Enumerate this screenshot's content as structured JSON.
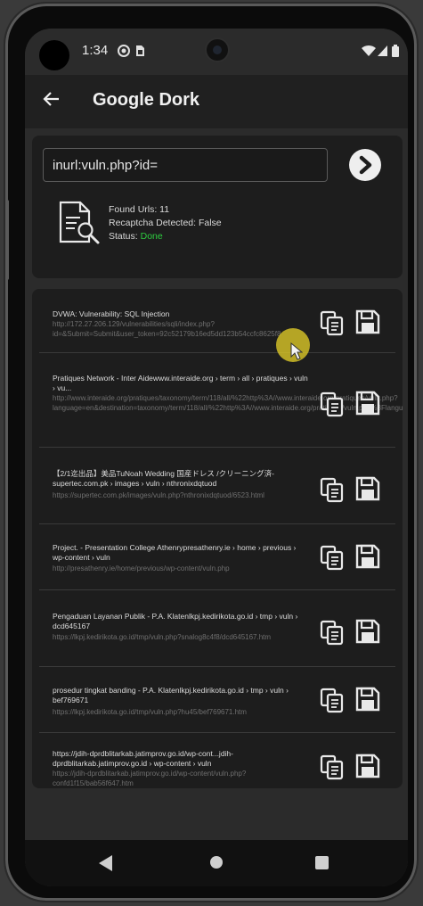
{
  "status_bar": {
    "time": "1:34",
    "icons": [
      "media-icon",
      "sim-icon",
      "wifi-icon",
      "signal-icon",
      "battery-icon"
    ]
  },
  "app_bar": {
    "title": "Google Dork"
  },
  "search": {
    "query": "inurl:vuln.php?id=",
    "found_label": "Found Urls: 11",
    "recaptcha_label": "Recaptcha Detected: False",
    "status_label": "Status: ",
    "status_value": "Done"
  },
  "results": [
    {
      "title": "DVWA: Vulnerability: SQL Injection",
      "url": "http://172.27.206.129/vulnerabilities/sqli/index.php?id=&Submit=Submit&user_token=92c52179b16ed5dd123b54ccfc8625f8"
    },
    {
      "title": "Pratiques Network - Inter Aidewww.interaide.org › term › all › pratiques › vuln › vu...",
      "url": "http://www.interaide.org/pratiques/taxonomy/term/118/all/%22http%3A//www.interaide.org/pratiques/vuln.php?language=en&destination=taxonomy/term/118/all/%22http%3A//www.interaide.org/pratiques/vuln.php%3Flanguage%3Den&page=27"
    },
    {
      "title": "【2/1迄出品】美品TuNoah Wedding 国産ドレス /クリーニング済-supertec.com.pk › images › vuln › nthronixdqtuod",
      "url": "https://supertec.com.pk/images/vuln.php?nthronixdqtuod/6523.html"
    },
    {
      "title": "Project. - Presentation College Athenrypresathenry.ie › home › previous › wp-content › vuln",
      "url": "http://presathenry.ie/home/previous/wp-content/vuln.php"
    },
    {
      "title": "Pengaduan Layanan Publik - P.A. Klatenlkpj.kedirikota.go.id › tmp › vuln › dcd645167",
      "url": "https://lkpj.kedirikota.go.id/tmp/vuln.php?snalog8c4f8/dcd645167.htm"
    },
    {
      "title": "prosedur tingkat banding - P.A. Klatenlkpj.kedirikota.go.id › tmp › vuln › bef769671",
      "url": "https://lkpj.kedirikota.go.id/tmp/vuln.php?hu45/bef769671.htm"
    },
    {
      "title": "https://jdih-dprdblitarkab.jatimprov.go.id/wp-cont...jdih-dprdblitarkab.jatimprov.go.id › wp-content › vuln",
      "url": "https://jdih-dprdblitarkab.jatimprov.go.id/wp-content/vuln.php?confd1f15/bab56f647.htm"
    }
  ],
  "colors": {
    "status_done": "#2ecc40",
    "background": "#2b2b2b",
    "card": "#1d1d1d"
  }
}
